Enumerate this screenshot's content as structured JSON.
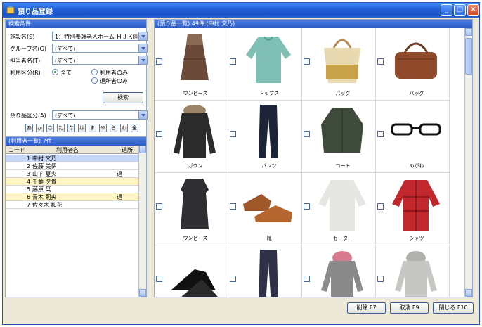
{
  "window": {
    "title": "預り品登録"
  },
  "left": {
    "header": "検索条件",
    "facility_label": "施設名(S)",
    "facility_value": "1：特別養護老人ホーム ＨＪＫ園",
    "group_label": "グループ名(G)",
    "group_value": "(すべて)",
    "staff_label": "担当者名(T)",
    "staff_value": "(すべて)",
    "usage_label": "利用区分(R)",
    "radio_all": "全て",
    "radio_users": "利用者のみ",
    "radio_left": "退所者のみ",
    "search_button": "検索",
    "category_label": "預り品区分(A)",
    "category_value": "(すべて)",
    "kana": [
      "あ",
      "か",
      "さ",
      "た",
      "な",
      "は",
      "ま",
      "や",
      "ら",
      "わ",
      "全"
    ]
  },
  "user_list": {
    "header": "(利用者一覧) 7件",
    "columns": [
      "コード",
      "利用者名",
      "退所"
    ],
    "rows": [
      {
        "code": "1",
        "name": "中村 文乃",
        "left": ""
      },
      {
        "code": "2",
        "name": "佐藤 美伊",
        "left": ""
      },
      {
        "code": "3",
        "name": "山下 夏央",
        "left": "退"
      },
      {
        "code": "4",
        "name": "千葉 夕貴",
        "left": ""
      },
      {
        "code": "5",
        "name": "藤原 栞",
        "left": ""
      },
      {
        "code": "6",
        "name": "青木 莉央",
        "left": "退"
      },
      {
        "code": "7",
        "name": "佐々木 和花",
        "left": ""
      }
    ]
  },
  "items": {
    "header": "(預り品一覧) 49件 (中村 文乃)",
    "captions": [
      "ワンピース",
      "トップス",
      "バッグ",
      "バッグ",
      "ガウン",
      "パンツ",
      "コート",
      "めがね",
      "ワンピース",
      "靴",
      "セーター",
      "シャツ",
      "",
      "",
      "",
      ""
    ]
  },
  "buttons": {
    "delete": "削除 F7",
    "cancel": "取消 F9",
    "close": "閉じる F10"
  },
  "colors": {
    "title_bar": "#1f5fd9",
    "selected_row": "#c5d6f7",
    "highlight_row": "#fff6c4"
  }
}
